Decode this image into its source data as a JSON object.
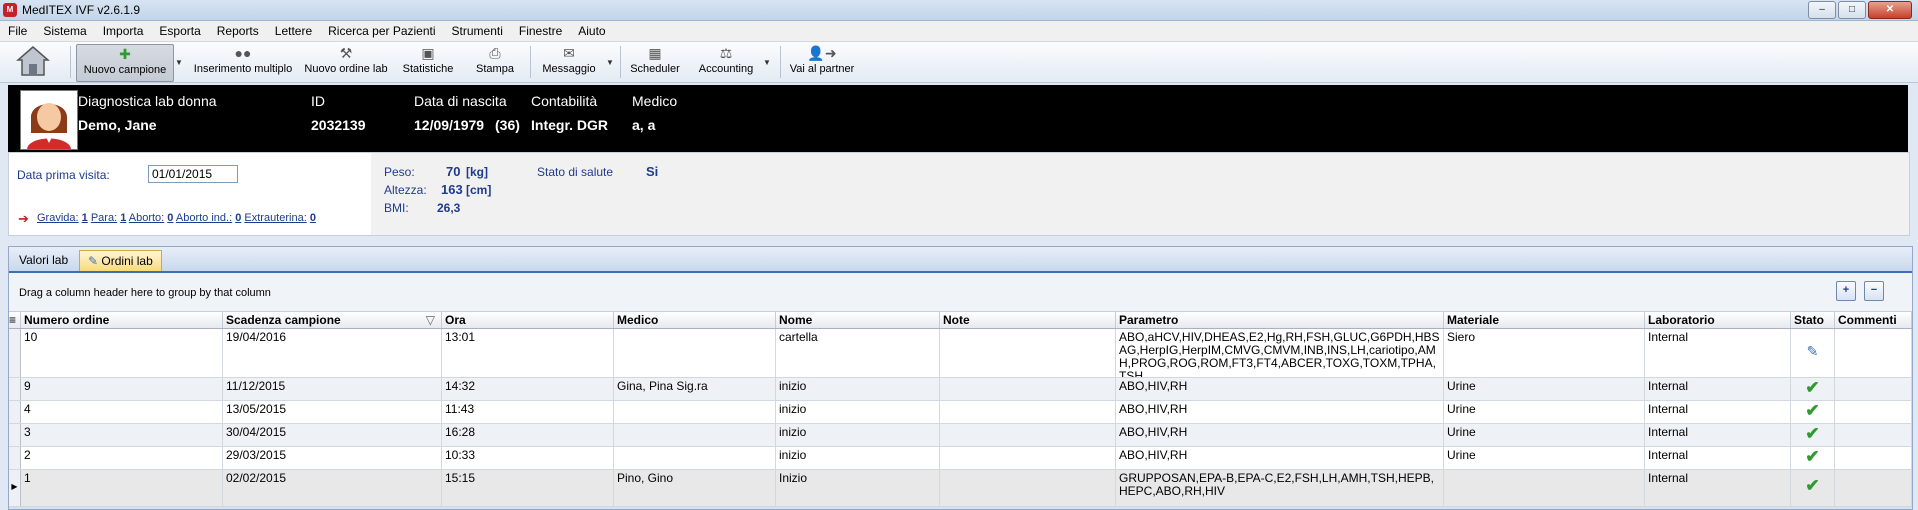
{
  "window": {
    "title": "MedITEX IVF v2.6.1.9",
    "app_icon": "meditex-icon"
  },
  "menu": [
    "File",
    "Sistema",
    "Importa",
    "Esporta",
    "Reports",
    "Lettere",
    "Ricerca per Pazienti",
    "Strumenti",
    "Finestre",
    "Aiuto"
  ],
  "toolbar": {
    "nuovo_campione": "Nuovo campione",
    "inserimento_multiplo": "Inserimento multiplo",
    "nuovo_ordine_lab": "Nuovo ordine lab",
    "statistiche": "Statistiche",
    "stampa": "Stampa",
    "messaggio": "Messaggio",
    "scheduler": "Scheduler",
    "accounting": "Accounting",
    "vai_al_partner": "Vai al partner"
  },
  "patient": {
    "context_label": "Diagnostica lab donna",
    "name": "Demo, Jane",
    "id_label": "ID",
    "id": "2032139",
    "dob_label": "Data di nascita",
    "dob": "12/09/1979",
    "age": "(36)",
    "contabilita_label": "Contabilità",
    "contabilita": "Integr. DGR",
    "medico_label": "Medico",
    "medico": "a, a"
  },
  "info": {
    "first_visit_label": "Data prima visita:",
    "first_visit": "01/01/2015",
    "obst": {
      "gravida_label": "Gravida:",
      "gravida": "1",
      "para_label": "Para:",
      "para": "1",
      "aborto_label": "Aborto:",
      "aborto": "0",
      "aborto_ind_label": "Aborto ind.:",
      "aborto_ind": "0",
      "extraut_label": "Extrauterina:",
      "extraut": "0"
    },
    "peso_label": "Peso:",
    "peso": "70",
    "peso_unit": "[kg]",
    "altezza_label": "Altezza:",
    "altezza": "163",
    "altezza_unit": "[cm]",
    "bmi_label": "BMI:",
    "bmi": "26,3",
    "salute_label": "Stato di salute",
    "salute": "Si"
  },
  "tabs": [
    "Valori lab",
    "Ordini lab"
  ],
  "group_hint": "Drag a column header here to group by that column",
  "columns": [
    "Numero ordine",
    "Scadenza campione",
    "Ora",
    "Medico",
    "Nome",
    "Note",
    "Parametro",
    "Materiale",
    "Laboratorio",
    "Stato",
    "Commenti"
  ],
  "rows": [
    {
      "numero": "10",
      "scadenza": "19/04/2016",
      "ora": "13:01",
      "medico": "",
      "nome": "cartella",
      "note": "",
      "parametro": "ABO,aHCV,HIV,DHEAS,E2,Hg,RH,FSH,GLUC,G6PDH,HBSAG,HerpIG,HerpIM,CMVG,CMVM,INB,INS,LH,cariotipo,AMH,PROG,ROG,ROM,FT3,FT4,ABCER,TOXG,TOXM,TPHA,TSH",
      "materiale": "Siero",
      "laboratorio": "Internal",
      "stato": "edit-icon",
      "commenti": ""
    },
    {
      "numero": "9",
      "scadenza": "11/12/2015",
      "ora": "14:32",
      "medico": "Gina, Pina Sig.ra",
      "nome": "inizio",
      "note": "",
      "parametro": "ABO,HIV,RH",
      "materiale": "Urine",
      "laboratorio": "Internal",
      "stato": "check-icon",
      "commenti": ""
    },
    {
      "numero": "4",
      "scadenza": "13/05/2015",
      "ora": "11:43",
      "medico": "",
      "nome": "inizio",
      "note": "",
      "parametro": "ABO,HIV,RH",
      "materiale": "Urine",
      "laboratorio": "Internal",
      "stato": "check-icon",
      "commenti": ""
    },
    {
      "numero": "3",
      "scadenza": "30/04/2015",
      "ora": "16:28",
      "medico": "",
      "nome": "inizio",
      "note": "",
      "parametro": "ABO,HIV,RH",
      "materiale": "Urine",
      "laboratorio": "Internal",
      "stato": "check-icon",
      "commenti": ""
    },
    {
      "numero": "2",
      "scadenza": "29/03/2015",
      "ora": "10:33",
      "medico": "",
      "nome": "inizio",
      "note": "",
      "parametro": "ABO,HIV,RH",
      "materiale": "Urine",
      "laboratorio": "Internal",
      "stato": "check-icon",
      "commenti": ""
    },
    {
      "numero": "1",
      "scadenza": "02/02/2015",
      "ora": "15:15",
      "medico": "Pino, Gino",
      "nome": "Inizio",
      "note": "",
      "parametro": "GRUPPOSAN,EPA-B,EPA-C,E2,FSH,LH,AMH,TSH,HEPB,HEPC,ABO,RH,HIV",
      "materiale": "",
      "laboratorio": "Internal",
      "stato": "check-icon",
      "commenti": ""
    }
  ]
}
